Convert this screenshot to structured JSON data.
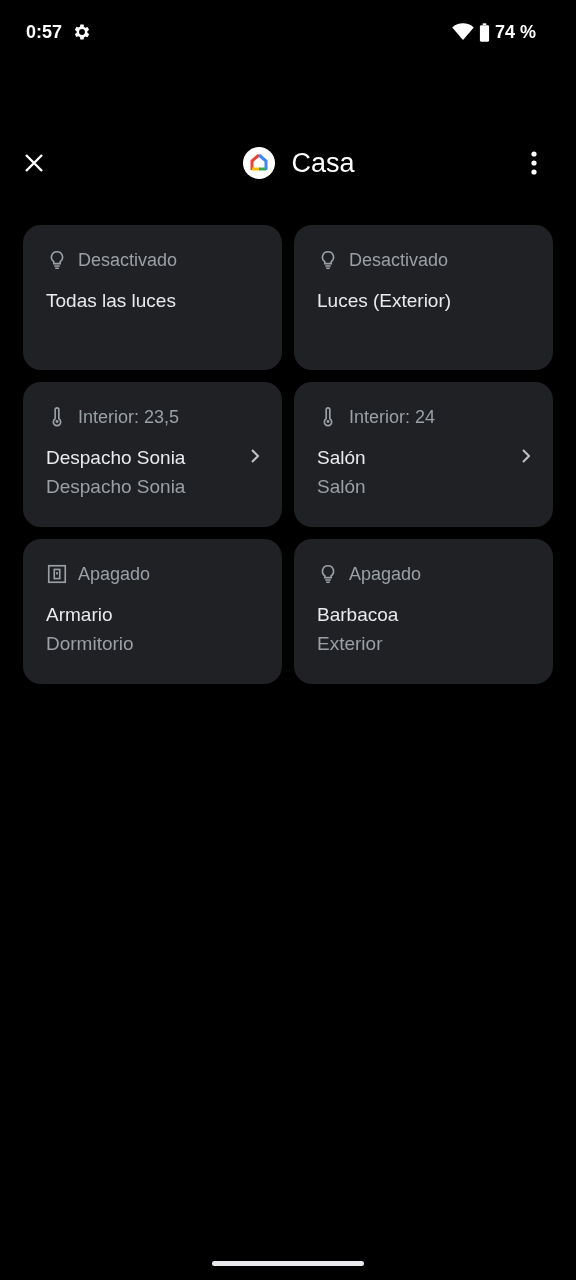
{
  "status_bar": {
    "time": "0:57",
    "battery": "74 %"
  },
  "header": {
    "title": "Casa"
  },
  "controls": [
    {
      "kind": "light",
      "status": "Desactivado",
      "name": "Todas las luces",
      "navigable": false
    },
    {
      "kind": "light",
      "status": "Desactivado",
      "name": "Luces (Exterior)",
      "navigable": false
    },
    {
      "kind": "thermostat",
      "status": "Interior: 23,5",
      "name": "Despacho Sonia",
      "room": "Despacho Sonia",
      "navigable": true
    },
    {
      "kind": "thermostat",
      "status": "Interior: 24",
      "name": "Salón",
      "room": "Salón",
      "navigable": true
    },
    {
      "kind": "outlet",
      "status": "Apagado",
      "name": "Armario",
      "room": "Dormitorio",
      "navigable": false
    },
    {
      "kind": "light",
      "status": "Apagado",
      "name": "Barbacoa",
      "room": "Exterior",
      "navigable": false
    }
  ]
}
